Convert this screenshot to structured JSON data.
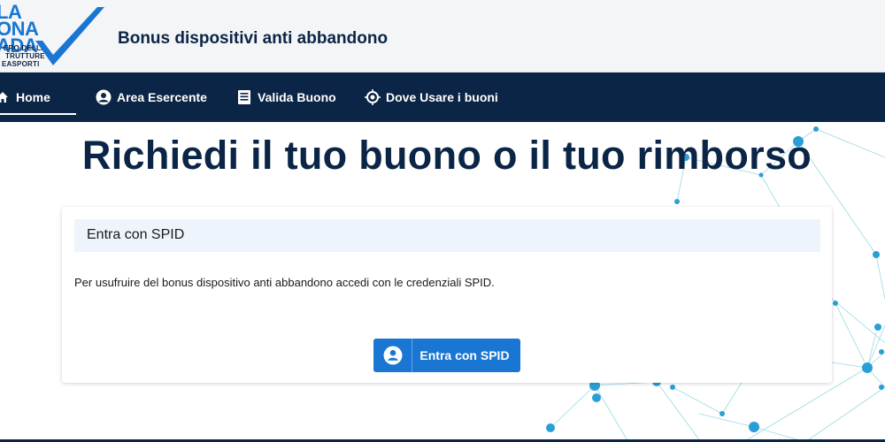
{
  "header": {
    "logo": {
      "line1": "LA",
      "line2": "ONA",
      "line3": "ADA",
      "small1": "ERO DELLE",
      "small2": "TRUTTURE",
      "small3": "EASPORTI"
    },
    "title": "Bonus dispositivi anti abbandono"
  },
  "nav": {
    "items": [
      {
        "label": "Home",
        "icon": "home-icon",
        "active": true
      },
      {
        "label": "Area Esercente",
        "icon": "user-circle-icon"
      },
      {
        "label": "Valida Buono",
        "icon": "document-list-icon"
      },
      {
        "label": "Dove Usare i buoni",
        "icon": "location-target-icon"
      }
    ]
  },
  "main": {
    "hero_title": "Richiedi il tuo buono o il tuo rimborso",
    "card": {
      "title": "Entra con SPID",
      "description": "Per usufruire del bonus dispositivo anti abbandono accedi con le credenziali SPID.",
      "button_label": "Entra con SPID",
      "button_icon": "user-icon"
    }
  },
  "colors": {
    "navy": "#0b2546",
    "brand_blue": "#1976d2",
    "network_cyan": "#2a9fd6",
    "card_head_bg": "#eef4fb"
  }
}
